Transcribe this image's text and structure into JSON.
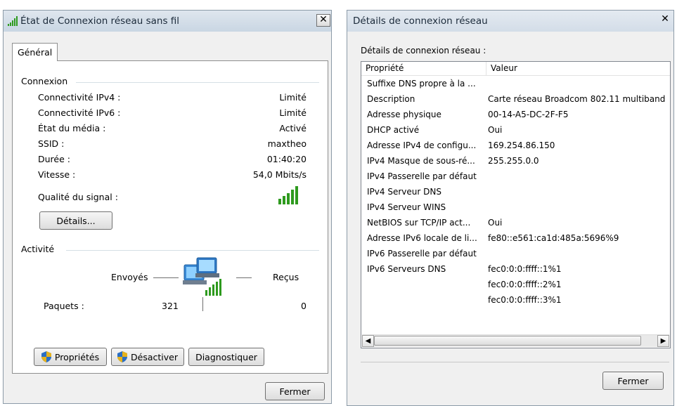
{
  "left_window": {
    "title": "État de Connexion réseau sans fil",
    "close_glyph": "✕",
    "tab_label": "Général",
    "connection": {
      "group_label": "Connexion",
      "rows": [
        {
          "label": "Connectivité IPv4 :",
          "value": "Limité"
        },
        {
          "label": "Connectivité IPv6 :",
          "value": "Limité"
        },
        {
          "label": "État du média :",
          "value": "Activé"
        },
        {
          "label": "SSID :",
          "value": "maxtheo"
        },
        {
          "label": "Durée :",
          "value": "01:40:20"
        },
        {
          "label": "Vitesse :",
          "value": "54,0 Mbits/s"
        }
      ],
      "signal_label": "Qualité du signal :",
      "signal_bars_lit": 5,
      "signal_bars_total": 5,
      "details_button": "Détails..."
    },
    "activity": {
      "group_label": "Activité",
      "sent_label": "Envoyés",
      "received_label": "Reçus",
      "packets_label": "Paquets :",
      "packets_sent": "321",
      "packets_received": "0"
    },
    "buttons": {
      "properties": "Propriétés",
      "disable": "Désactiver",
      "diagnose": "Diagnostiquer",
      "close": "Fermer"
    },
    "colors": {
      "signal_green": "#2e9a1e"
    }
  },
  "right_window": {
    "title": "Détails de connexion réseau",
    "close_glyph": "✕",
    "list_caption": "Détails de connexion réseau :",
    "columns": [
      "Propriété",
      "Valeur"
    ],
    "rows": [
      {
        "property": "Suffixe DNS propre à la ...",
        "value": ""
      },
      {
        "property": "Description",
        "value": "Carte réseau Broadcom 802.11 multiband"
      },
      {
        "property": "Adresse physique",
        "value": "00-14-A5-DC-2F-F5"
      },
      {
        "property": "DHCP activé",
        "value": "Oui"
      },
      {
        "property": "Adresse IPv4 de configu...",
        "value": "169.254.86.150"
      },
      {
        "property": "IPv4 Masque de sous-ré...",
        "value": "255.255.0.0"
      },
      {
        "property": "IPv4 Passerelle par défaut",
        "value": ""
      },
      {
        "property": "IPv4 Serveur DNS",
        "value": ""
      },
      {
        "property": "IPv4 Serveur WINS",
        "value": ""
      },
      {
        "property": "NetBIOS sur TCP/IP act...",
        "value": "Oui"
      },
      {
        "property": "Adresse IPv6 locale de li...",
        "value": "fe80::e561:ca1d:485a:5696%9"
      },
      {
        "property": "IPv6 Passerelle par défaut",
        "value": ""
      },
      {
        "property": "IPv6 Serveurs DNS",
        "value": "fec0:0:0:ffff::1%1"
      },
      {
        "property": "",
        "value": "fec0:0:0:ffff::2%1"
      },
      {
        "property": "",
        "value": "fec0:0:0:ffff::3%1"
      }
    ],
    "scroll_left_glyph": "◀",
    "scroll_right_glyph": "▶",
    "close_button": "Fermer"
  }
}
